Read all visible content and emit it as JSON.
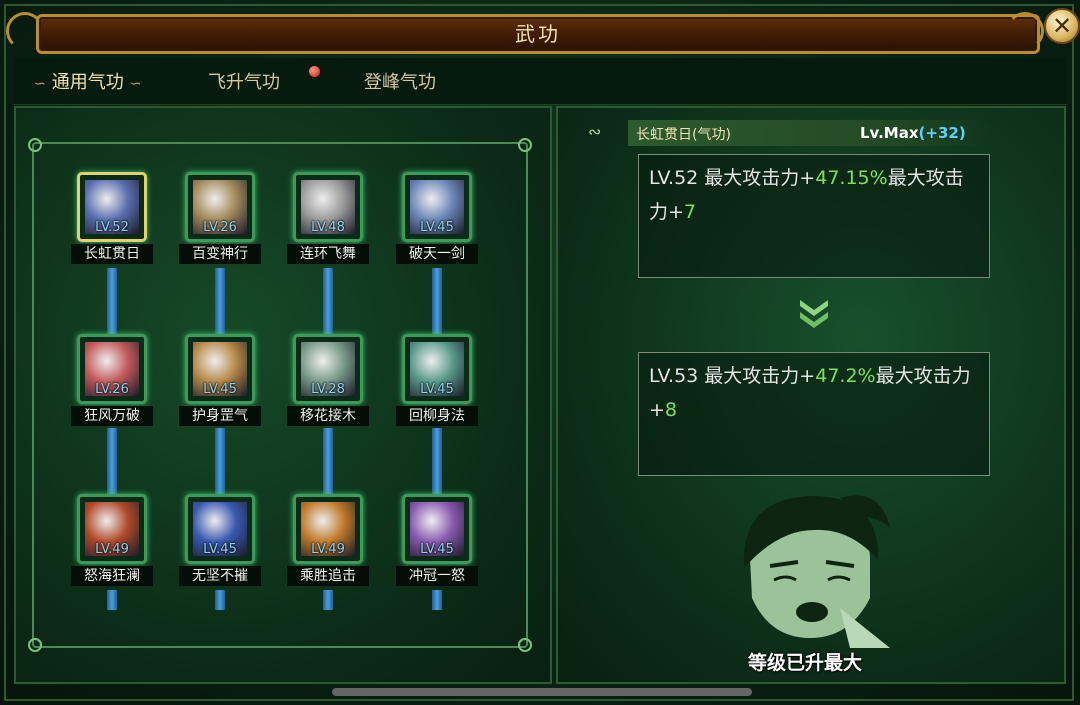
{
  "window": {
    "title": "武功"
  },
  "tabs": [
    {
      "label": "通用气功",
      "active": true
    },
    {
      "label": "飞升气功",
      "active": false,
      "notify": true
    },
    {
      "label": "登峰气功",
      "active": false
    }
  ],
  "skills": [
    {
      "name": "长虹贯日",
      "level": "LV.52",
      "icon": "blade-slash-icon",
      "color": "#5a6fb0"
    },
    {
      "name": "百变神行",
      "level": "LV.26",
      "icon": "claw-streak-icon",
      "color": "#a38a5a"
    },
    {
      "name": "连环飞舞",
      "level": "LV.48",
      "icon": "swords-icon",
      "color": "#9a9a9a"
    },
    {
      "name": "破天一剑",
      "level": "LV.45",
      "icon": "sword-burst-icon",
      "color": "#6c86b8"
    },
    {
      "name": "狂风万破",
      "level": "LV.26",
      "icon": "warrior-portrait-icon",
      "color": "#c35a5a"
    },
    {
      "name": "护身罡气",
      "level": "LV.45",
      "icon": "monk-portrait-icon",
      "color": "#b78a4a"
    },
    {
      "name": "移花接木",
      "level": "LV.28",
      "icon": "spear-light-icon",
      "color": "#7a9a8a"
    },
    {
      "name": "回柳身法",
      "level": "LV.45",
      "icon": "swirl-figure-icon",
      "color": "#5a9a8a"
    },
    {
      "name": "怒海狂澜",
      "level": "LV.49",
      "icon": "flame-spear-icon",
      "color": "#b04a2a"
    },
    {
      "name": "无坚不摧",
      "level": "LV.45",
      "icon": "lightning-blade-icon",
      "color": "#3a5ab0"
    },
    {
      "name": "乘胜追击",
      "level": "LV.49",
      "icon": "fire-fighter-icon",
      "color": "#c07a2a"
    },
    {
      "name": "冲冠一怒",
      "level": "LV.45",
      "icon": "tiger-icon",
      "color": "#8a5ab0"
    }
  ],
  "detail": {
    "skill_name": "长虹贯日(气功)",
    "level_label": "Lv.Max",
    "level_bonus": "(+32)",
    "current": {
      "prefix": "LV.52 最大攻击力+",
      "value1": "47.15%",
      "mid": "最大攻击力+",
      "value2": "7"
    },
    "next": {
      "prefix": "LV.53 最大攻击力+",
      "value1": "47.2%",
      "mid": "最大攻击力+",
      "value2": "8"
    },
    "max_message": "等级已升最大"
  },
  "colors": {
    "accent_gold": "#b98d2b",
    "value_green": "#7ee24f",
    "bonus_blue": "#5fd1ff",
    "pipe_blue": "#4d9fe0"
  }
}
